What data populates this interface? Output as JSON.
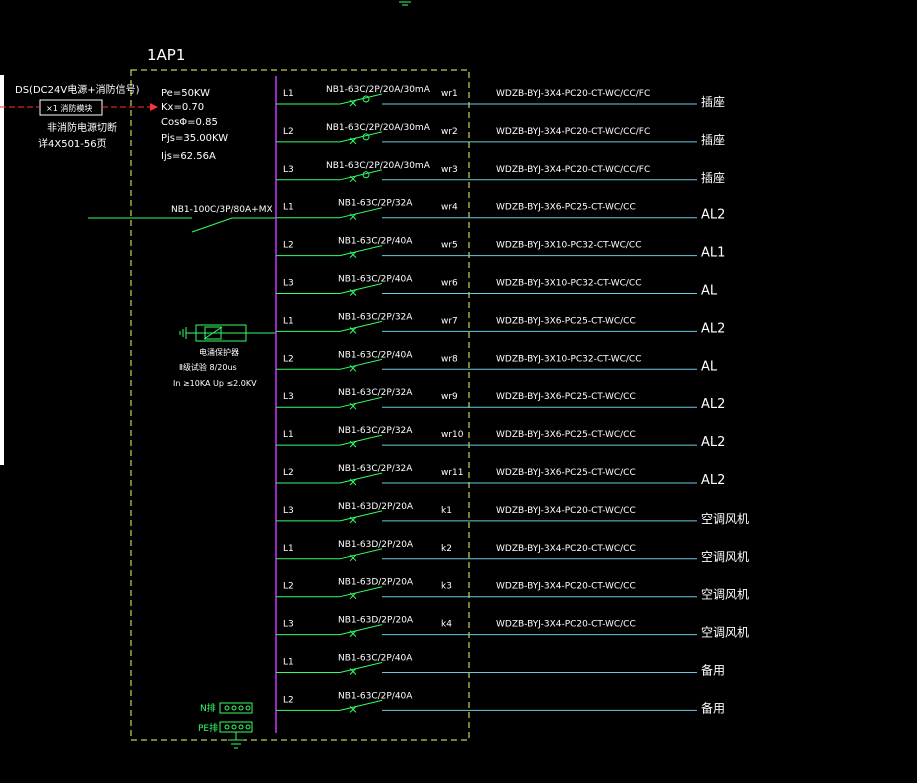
{
  "colors": {
    "background": "#000000",
    "bus": "#cc33ff",
    "panel_border": "#ffff66",
    "breaker": "#33ff66",
    "feeder_line": "#66ccdd",
    "incoming_line": "#33ff66",
    "fire_signal": "#ff3333",
    "text": "#ffffff"
  },
  "panel": {
    "name": "1AP1",
    "params": [
      "Pe=50KW",
      "Kx=0.70",
      "CosΦ=0.85",
      "Pjs=35.00KW",
      "Ijs=62.56A"
    ]
  },
  "fire_module": {
    "header": "DS(DC24V电源+消防信号)",
    "module_label": "×1 消防模块",
    "note_line1": "非消防电源切断",
    "note_line2": "详4X501-56页"
  },
  "incoming": {
    "breaker": "NB1-100C/3P/80A+MX"
  },
  "spd": {
    "title": "电涌保护器",
    "spec1": "Ⅱ级试验  8/20us",
    "spec2": "In ≥10KA   Up ≤2.0KV"
  },
  "terminals": {
    "n": "N排",
    "pe": "PE排"
  },
  "circuits": [
    {
      "phase": "L1",
      "breaker": "NB1-63C/2P/20A/30mA",
      "id": "wr1",
      "cable": "WDZB-BYJ-3X4-PC20-CT-WC/CC/FC",
      "dest": "插座",
      "rcd": true
    },
    {
      "phase": "L2",
      "breaker": "NB1-63C/2P/20A/30mA",
      "id": "wr2",
      "cable": "WDZB-BYJ-3X4-PC20-CT-WC/CC/FC",
      "dest": "插座",
      "rcd": true
    },
    {
      "phase": "L3",
      "breaker": "NB1-63C/2P/20A/30mA",
      "id": "wr3",
      "cable": "WDZB-BYJ-3X4-PC20-CT-WC/CC/FC",
      "dest": "插座",
      "rcd": true
    },
    {
      "phase": "L1",
      "breaker": "NB1-63C/2P/32A",
      "id": "wr4",
      "cable": "WDZB-BYJ-3X6-PC25-CT-WC/CC",
      "dest": "AL2",
      "rcd": false
    },
    {
      "phase": "L2",
      "breaker": "NB1-63C/2P/40A",
      "id": "wr5",
      "cable": "WDZB-BYJ-3X10-PC32-CT-WC/CC",
      "dest": "AL1",
      "rcd": false
    },
    {
      "phase": "L3",
      "breaker": "NB1-63C/2P/40A",
      "id": "wr6",
      "cable": "WDZB-BYJ-3X10-PC32-CT-WC/CC",
      "dest": "AL",
      "rcd": false
    },
    {
      "phase": "L1",
      "breaker": "NB1-63C/2P/32A",
      "id": "wr7",
      "cable": "WDZB-BYJ-3X6-PC25-CT-WC/CC",
      "dest": "AL2",
      "rcd": false
    },
    {
      "phase": "L2",
      "breaker": "NB1-63C/2P/40A",
      "id": "wr8",
      "cable": "WDZB-BYJ-3X10-PC32-CT-WC/CC",
      "dest": "AL",
      "rcd": false
    },
    {
      "phase": "L3",
      "breaker": "NB1-63C/2P/32A",
      "id": "wr9",
      "cable": "WDZB-BYJ-3X6-PC25-CT-WC/CC",
      "dest": "AL2",
      "rcd": false
    },
    {
      "phase": "L1",
      "breaker": "NB1-63C/2P/32A",
      "id": "wr10",
      "cable": "WDZB-BYJ-3X6-PC25-CT-WC/CC",
      "dest": "AL2",
      "rcd": false
    },
    {
      "phase": "L2",
      "breaker": "NB1-63C/2P/32A",
      "id": "wr11",
      "cable": "WDZB-BYJ-3X6-PC25-CT-WC/CC",
      "dest": "AL2",
      "rcd": false
    },
    {
      "phase": "L3",
      "breaker": "NB1-63D/2P/20A",
      "id": "k1",
      "cable": "WDZB-BYJ-3X4-PC20-CT-WC/CC",
      "dest": "空调风机",
      "rcd": false
    },
    {
      "phase": "L1",
      "breaker": "NB1-63D/2P/20A",
      "id": "k2",
      "cable": "WDZB-BYJ-3X4-PC20-CT-WC/CC",
      "dest": "空调风机",
      "rcd": false
    },
    {
      "phase": "L2",
      "breaker": "NB1-63D/2P/20A",
      "id": "k3",
      "cable": "WDZB-BYJ-3X4-PC20-CT-WC/CC",
      "dest": "空调风机",
      "rcd": false
    },
    {
      "phase": "L3",
      "breaker": "NB1-63D/2P/20A",
      "id": "k4",
      "cable": "WDZB-BYJ-3X4-PC20-CT-WC/CC",
      "dest": "空调风机",
      "rcd": false
    },
    {
      "phase": "L1",
      "breaker": "NB1-63C/2P/40A",
      "id": "",
      "cable": "",
      "dest": "备用",
      "rcd": false
    },
    {
      "phase": "L2",
      "breaker": "NB1-63C/2P/40A",
      "id": "",
      "cable": "",
      "dest": "备用",
      "rcd": false
    }
  ]
}
